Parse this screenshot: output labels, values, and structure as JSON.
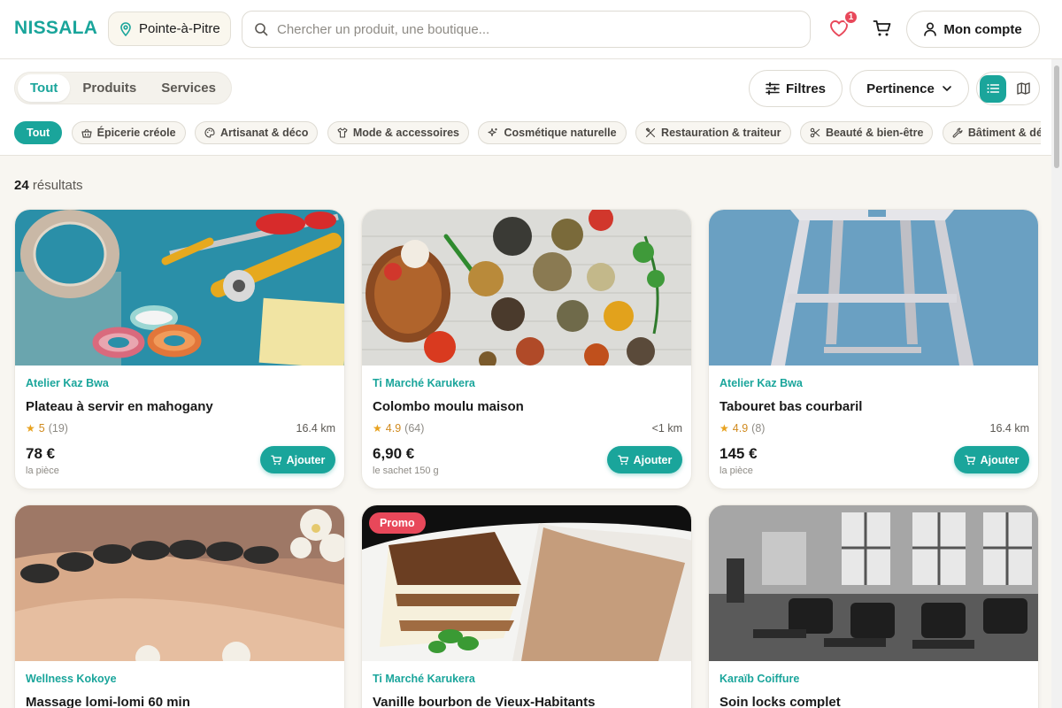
{
  "header": {
    "logo": "NISSALA",
    "location": "Pointe-à-Pitre",
    "search_placeholder": "Chercher un produit, une boutique...",
    "favorites_count": "1",
    "account_label": "Mon compte"
  },
  "tabs": [
    {
      "label": "Tout",
      "active": true
    },
    {
      "label": "Produits",
      "active": false
    },
    {
      "label": "Services",
      "active": false
    }
  ],
  "filters_label": "Filtres",
  "sort_label": "Pertinence",
  "categories": [
    {
      "label": "Tout",
      "icon": "none",
      "active": true
    },
    {
      "label": "Épicerie créole",
      "icon": "basket-icon"
    },
    {
      "label": "Artisanat & déco",
      "icon": "palette-icon"
    },
    {
      "label": "Mode & accessoires",
      "icon": "shirt-icon"
    },
    {
      "label": "Cosmétique naturelle",
      "icon": "sparkles-icon"
    },
    {
      "label": "Restauration & traiteur",
      "icon": "utensils-icon"
    },
    {
      "label": "Beauté & bien-être",
      "icon": "scissors-icon"
    },
    {
      "label": "Bâtiment & dépa",
      "icon": "wrench-icon"
    }
  ],
  "results": {
    "count": "24",
    "label": "résultats"
  },
  "products": [
    {
      "shop": "Atelier Kaz Bwa",
      "title": "Plateau à servir en mahogany",
      "rating": "5",
      "reviews": "(19)",
      "distance": "16.4 km",
      "price": "78 €",
      "unit": "la pièce",
      "add_label": "Ajouter",
      "image": "craft-tools"
    },
    {
      "shop": "Ti Marché Karukera",
      "title": "Colombo moulu maison",
      "rating": "4.9",
      "reviews": "(64)",
      "distance": "<1 km",
      "price": "6,90 €",
      "unit": "le sachet 150 g",
      "add_label": "Ajouter",
      "image": "spices"
    },
    {
      "shop": "Atelier Kaz Bwa",
      "title": "Tabouret bas courbaril",
      "rating": "4.9",
      "reviews": "(8)",
      "distance": "16.4 km",
      "price": "145 €",
      "unit": "la pièce",
      "add_label": "Ajouter",
      "image": "stool"
    },
    {
      "shop": "Wellness Kokoye",
      "title": "Massage lomi-lomi 60 min",
      "image": "hot-stones"
    },
    {
      "shop": "Ti Marché Karukera",
      "title": "Vanille bourbon de Vieux-Habitants",
      "promo": "Promo",
      "image": "tiramisu"
    },
    {
      "shop": "Karaïb Coiffure",
      "title": "Soin locks complet",
      "image": "salon"
    }
  ]
}
